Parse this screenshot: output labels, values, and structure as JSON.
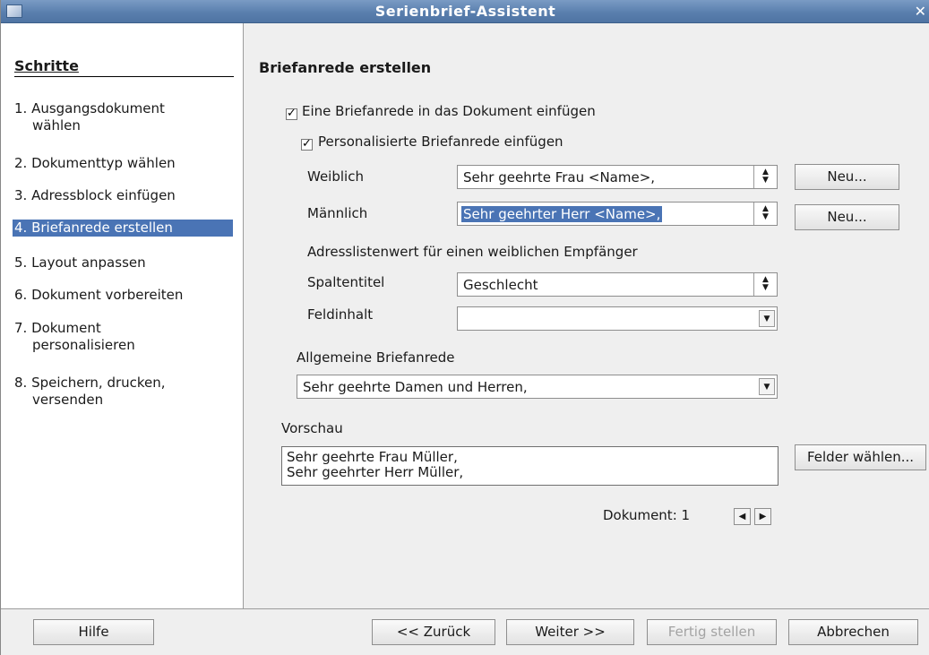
{
  "window": {
    "title": "Serienbrief-Assistent"
  },
  "sidebar": {
    "heading": "Schritte",
    "steps": [
      {
        "label": "1. Ausgangsdokument",
        "label2": "wählen"
      },
      {
        "label": "2. Dokumenttyp wählen"
      },
      {
        "label": "3. Adressblock einfügen"
      },
      {
        "label": "4. Briefanrede erstellen",
        "active": true
      },
      {
        "label": "5. Layout anpassen"
      },
      {
        "label": "6. Dokument vorbereiten"
      },
      {
        "label": "7. Dokument",
        "label2": "personalisieren"
      },
      {
        "label": "8. Speichern, drucken,",
        "label2": "versenden"
      }
    ]
  },
  "main": {
    "title": "Briefanrede erstellen",
    "insert_salutation": "Eine Briefanrede in das Dokument einfügen",
    "personalized": "Personalisierte Briefanrede einfügen",
    "female_label": "Weiblich",
    "female_value": "Sehr geehrte Frau <Name>,",
    "male_label": "Männlich",
    "male_value": "Sehr geehrter Herr <Name>,",
    "new_button_1": "Neu...",
    "new_button_2": "Neu...",
    "address_list_hint": "Adresslistenwert für einen weiblichen Empfänger",
    "column_label": "Spaltentitel",
    "column_value": "Geschlecht",
    "field_content_label": "Feldinhalt",
    "field_content_value": "",
    "general_label": "Allgemeine Briefanrede",
    "general_value": "Sehr geehrte Damen und Herren,",
    "preview_label": "Vorschau",
    "preview_line1": "Sehr geehrte Frau Müller,",
    "preview_line2": "Sehr geehrter Herr Müller,",
    "select_fields_button": "Felder wählen...",
    "document_label": "Dokument: 1"
  },
  "footer": {
    "help": "Hilfe",
    "back": "<< Zurück",
    "next": "Weiter >>",
    "finish": "Fertig stellen",
    "cancel": "Abbrechen"
  },
  "icons": {
    "app": "window-icon",
    "close": "close-icon",
    "spin": "spin-button-icon",
    "dropdown": "chevron-down-icon",
    "prev": "triangle-left-icon",
    "next": "triangle-right-icon"
  }
}
